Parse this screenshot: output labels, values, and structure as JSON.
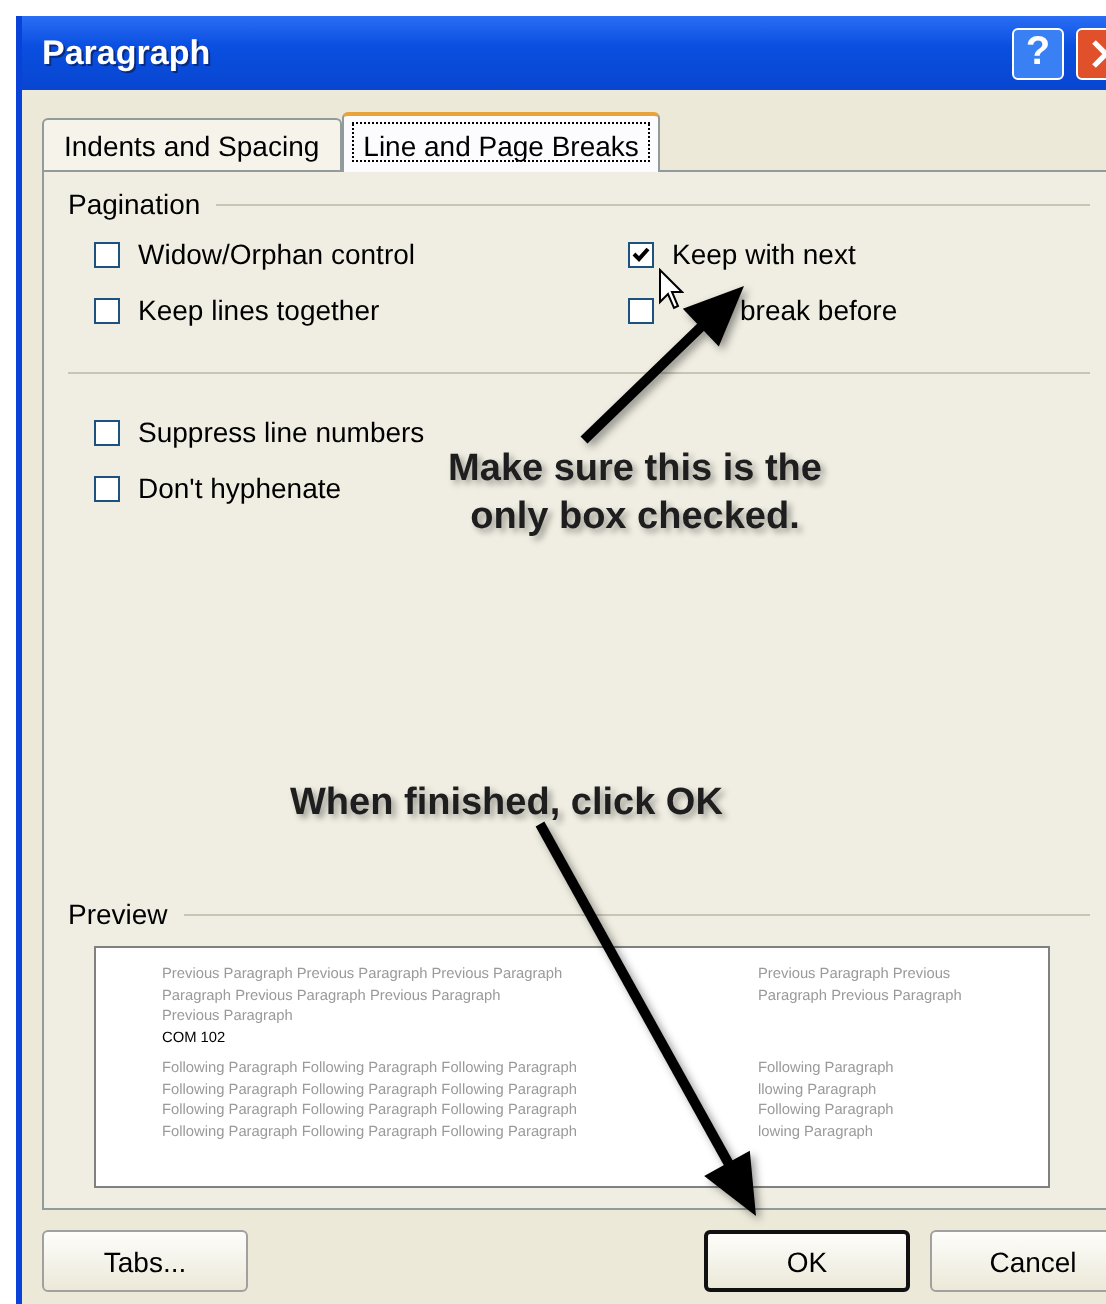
{
  "window": {
    "title": "Paragraph",
    "help_button": "?"
  },
  "tabs": [
    {
      "label": "Indents and Spacing",
      "selected": false
    },
    {
      "label": "Line and Page Breaks",
      "selected": true
    }
  ],
  "pagination": {
    "heading": "Pagination",
    "options": [
      {
        "label": "Widow/Orphan control",
        "checked": false,
        "obscured": false
      },
      {
        "label": "Keep with next",
        "checked": true,
        "obscured": false
      },
      {
        "label": "Keep lines together",
        "checked": false,
        "obscured": false
      },
      {
        "label": "break before",
        "checked": false,
        "obscured": true
      }
    ]
  },
  "formatting": {
    "options": [
      {
        "label": "Suppress line numbers",
        "checked": false
      },
      {
        "label": "Don't hyphenate",
        "checked": false
      }
    ]
  },
  "preview": {
    "heading": "Preview",
    "previous_lines": [
      [
        "Previous Paragraph Previous Paragraph Previous Paragraph",
        "Previous Paragraph Previous"
      ],
      [
        "Paragraph Previous Paragraph Previous Paragraph",
        "Paragraph Previous Paragraph"
      ],
      [
        "Previous Paragraph"
      ]
    ],
    "current_text": "COM 102",
    "following_lines": [
      [
        "Following Paragraph Following Paragraph Following Paragraph",
        "Following Paragraph"
      ],
      [
        "Following Paragraph Following Paragraph Following Paragraph",
        "llowing Paragraph"
      ],
      [
        "Following Paragraph Following Paragraph Following Paragraph",
        "Following Paragraph"
      ],
      [
        "Following Paragraph Following Paragraph Following Paragraph",
        "lowing Paragraph"
      ]
    ]
  },
  "buttons": [
    {
      "label": "Tabs...",
      "default": false
    },
    {
      "label": "OK",
      "default": true
    },
    {
      "label": "Cancel",
      "default": false
    }
  ],
  "annotations": [
    {
      "text": "Make sure this is the only box checked."
    },
    {
      "text": "When finished, click OK"
    }
  ]
}
